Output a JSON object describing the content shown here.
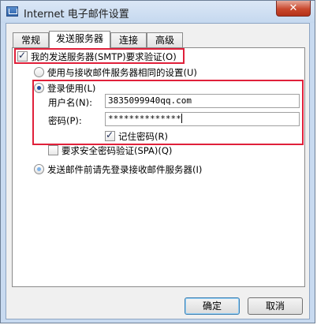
{
  "window": {
    "title": "Internet 电子邮件设置",
    "close_label": "✕"
  },
  "tabs": [
    {
      "label": "常规"
    },
    {
      "label": "发送服务器",
      "active": true
    },
    {
      "label": "连接"
    },
    {
      "label": "高级"
    }
  ],
  "outgoing": {
    "requires_auth_label": "我的发送服务器(SMTP)要求验证(O)",
    "requires_auth_checked": true,
    "use_same_settings_label": "使用与接收邮件服务器相同的设置(U)",
    "login_using_label": "登录使用(L)",
    "username_label": "用户名(N):",
    "username_value": "3835099940qq.com",
    "password_label": "密码(P):",
    "password_value": "**************",
    "remember_password_label": "记住密码(R)",
    "remember_password_checked": true,
    "spa_label": "要求安全密码验证(SPA)(Q)",
    "spa_checked": false,
    "login_first_label": "发送邮件前请先登录接收邮件服务器(I)"
  },
  "buttons": {
    "ok": "确定",
    "cancel": "取消"
  },
  "colors": {
    "highlight": "#e0203a",
    "title_bar": "#c8daf0",
    "close_button": "#c9482d"
  }
}
